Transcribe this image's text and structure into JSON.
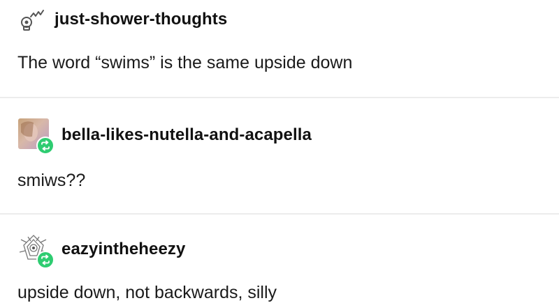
{
  "posts": [
    {
      "username": "just-shower-thoughts",
      "avatar_icon": "lightbulb-icon",
      "reblogged": false,
      "body": "The word “swims” is the same upside down"
    },
    {
      "username": "bella-likes-nutella-and-acapella",
      "avatar_icon": "photo-avatar",
      "reblogged": true,
      "body": "smiws??"
    },
    {
      "username": "eazyintheheezy",
      "avatar_icon": "sketch-avatar",
      "reblogged": true,
      "body": "upside down, not backwards, silly"
    }
  ],
  "colors": {
    "reblog_badge": "#2ecc71",
    "divider": "#ececec",
    "text": "#1a1a1a"
  }
}
